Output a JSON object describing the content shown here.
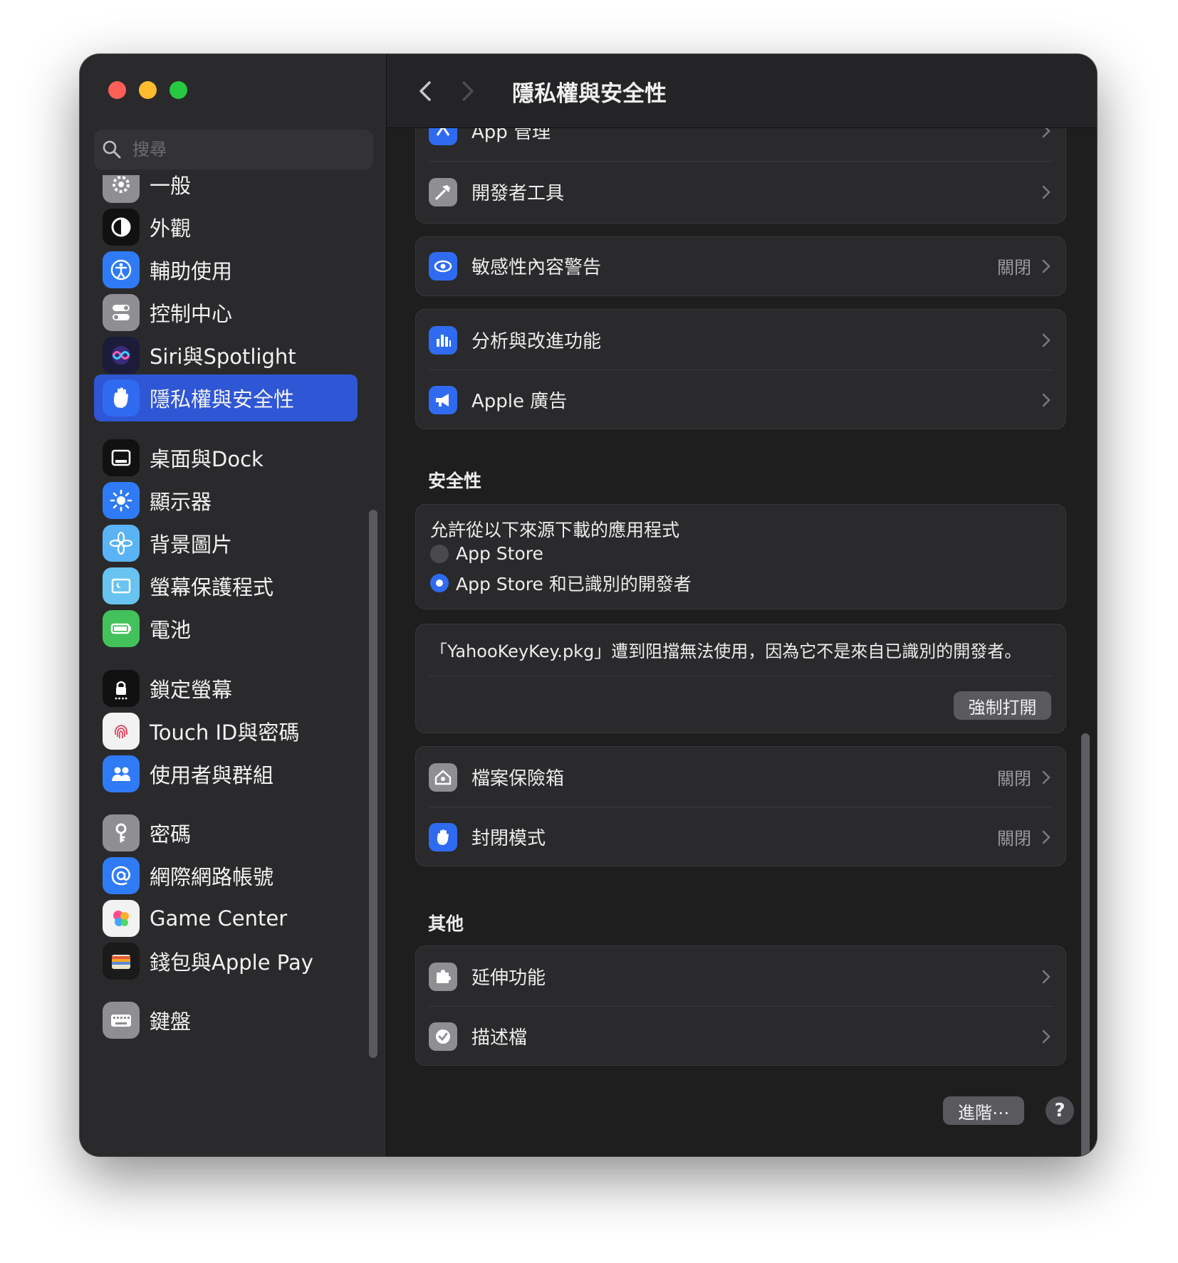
{
  "window": {
    "title": "隱私權與安全性"
  },
  "search": {
    "placeholder": "搜尋"
  },
  "sidebar": {
    "items": [
      {
        "label": "一般",
        "icon": "gear-icon",
        "color": "#8e8e93"
      },
      {
        "label": "外觀",
        "icon": "appearance-icon",
        "color": "#111111"
      },
      {
        "label": "輔助使用",
        "icon": "accessibility-icon",
        "color": "#2f7bf5"
      },
      {
        "label": "控制中心",
        "icon": "toggles-icon",
        "color": "#8e8e93"
      },
      {
        "label": "Siri與Spotlight",
        "icon": "siri-icon",
        "color": "#1b1b3a"
      },
      {
        "label": "隱私權與安全性",
        "icon": "hand-icon",
        "color": "#2f6bf0",
        "selected": true
      },
      {
        "label": "桌面與Dock",
        "icon": "dock-icon",
        "color": "#111111"
      },
      {
        "label": "顯示器",
        "icon": "sun-icon",
        "color": "#2f7bf5"
      },
      {
        "label": "背景圖片",
        "icon": "flower-icon",
        "color": "#5ab3f5"
      },
      {
        "label": "螢幕保護程式",
        "icon": "screensaver-icon",
        "color": "#69c3f0"
      },
      {
        "label": "電池",
        "icon": "battery-icon",
        "color": "#43c15a"
      },
      {
        "label": "鎖定螢幕",
        "icon": "lock-icon",
        "color": "#111111"
      },
      {
        "label": "Touch ID與密碼",
        "icon": "fingerprint-icon",
        "color": "#f2f2f2"
      },
      {
        "label": "使用者與群組",
        "icon": "users-icon",
        "color": "#2f7bf5"
      },
      {
        "label": "密碼",
        "icon": "key-icon",
        "color": "#8e8e93"
      },
      {
        "label": "網際網路帳號",
        "icon": "at-icon",
        "color": "#2f7bf5"
      },
      {
        "label": "Game Center",
        "icon": "game-center-icon",
        "color": "#f2f2f2"
      },
      {
        "label": "錢包與Apple Pay",
        "icon": "wallet-icon",
        "color": "#1a1a1a"
      },
      {
        "label": "鍵盤",
        "icon": "keyboard-icon",
        "color": "#8e8e93"
      }
    ]
  },
  "main": {
    "partial_row": {
      "label": "App 管理",
      "icon": "app-management-icon"
    },
    "rows1": [
      {
        "label": "開發者工具",
        "icon": "hammer-icon",
        "color": "#8e8e93"
      }
    ],
    "sensitive": {
      "label": "敏感性內容警告",
      "value": "關閉",
      "icon": "eye-icon",
      "color": "#2f6bf0"
    },
    "group2": [
      {
        "label": "分析與改進功能",
        "icon": "bar-chart-icon",
        "color": "#2f6bf0"
      },
      {
        "label": "Apple 廣告",
        "icon": "megaphone-icon",
        "color": "#2f6bf0"
      }
    ],
    "security": {
      "title": "安全性",
      "allow_label": "允許從以下來源下載的應用程式",
      "options": [
        {
          "label": "App Store",
          "checked": false
        },
        {
          "label": "App Store 和已識別的開發者",
          "checked": true
        }
      ]
    },
    "blocked": {
      "message": "「YahooKeyKey.pkg」遭到阻擋無法使用，因為它不是來自已識別的開發者。",
      "button": "強制打開"
    },
    "group3": [
      {
        "label": "檔案保險箱",
        "value": "關閉",
        "icon": "house-lock-icon",
        "color": "#8e8e93"
      },
      {
        "label": "封閉模式",
        "value": "關閉",
        "icon": "hand-icon",
        "color": "#2f6bf0"
      }
    ],
    "other": {
      "title": "其他",
      "rows": [
        {
          "label": "延伸功能",
          "icon": "puzzle-icon",
          "color": "#8e8e93"
        },
        {
          "label": "描述檔",
          "icon": "checkmark-seal-icon",
          "color": "#8e8e93"
        }
      ]
    },
    "footer": {
      "advanced": "進階⋯",
      "help": "?"
    }
  }
}
